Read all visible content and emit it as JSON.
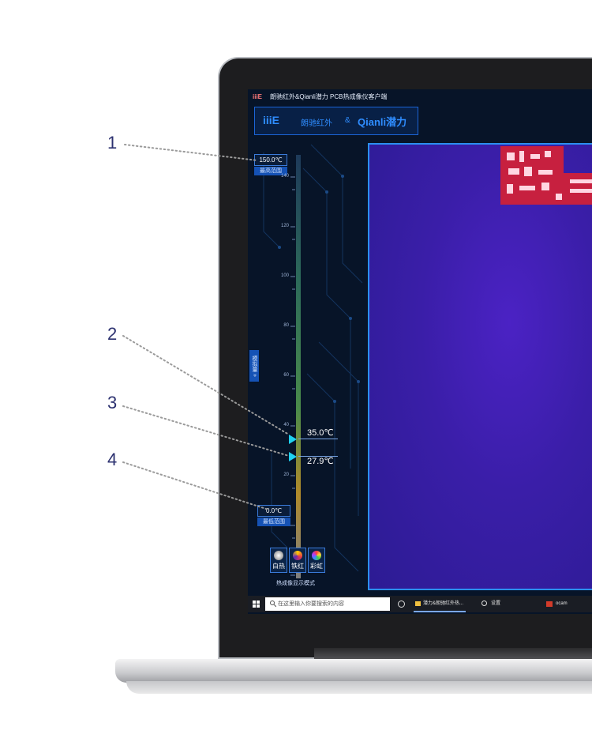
{
  "callouts": [
    "1",
    "2",
    "3",
    "4"
  ],
  "app": {
    "title": "朗驰红外&Qianli潜力 PCB热成像仪客户端",
    "logo_glyph": "iiiE",
    "brand_main": "iiiE",
    "brand_cn": "朗驰红外",
    "brand_amp": "&",
    "brand_partner": "Qianli潜力"
  },
  "scale": {
    "max_value": "150.0℃",
    "max_caption": "最高范围",
    "min_value": "0.0℃",
    "min_caption": "最低范围",
    "ticks": [
      "140",
      "120",
      "100",
      "80",
      "60",
      "40",
      "20"
    ],
    "marker_high": "35.0℃",
    "marker_low": "27.9℃",
    "side_tab": "模拟量 »"
  },
  "modes": {
    "items": [
      {
        "label": "白热",
        "color": "#cfcfcf"
      },
      {
        "label": "铁红",
        "color": "#d4375c"
      },
      {
        "label": "彩虹",
        "color": "#7a4bd6"
      }
    ],
    "caption": "热成像显示模式"
  },
  "taskbar": {
    "search_placeholder": "在这里输入你要搜索的内容",
    "items": [
      {
        "label": "潜力&朗驰红外热..."
      },
      {
        "label": "设置"
      },
      {
        "label": "ocam"
      }
    ]
  }
}
